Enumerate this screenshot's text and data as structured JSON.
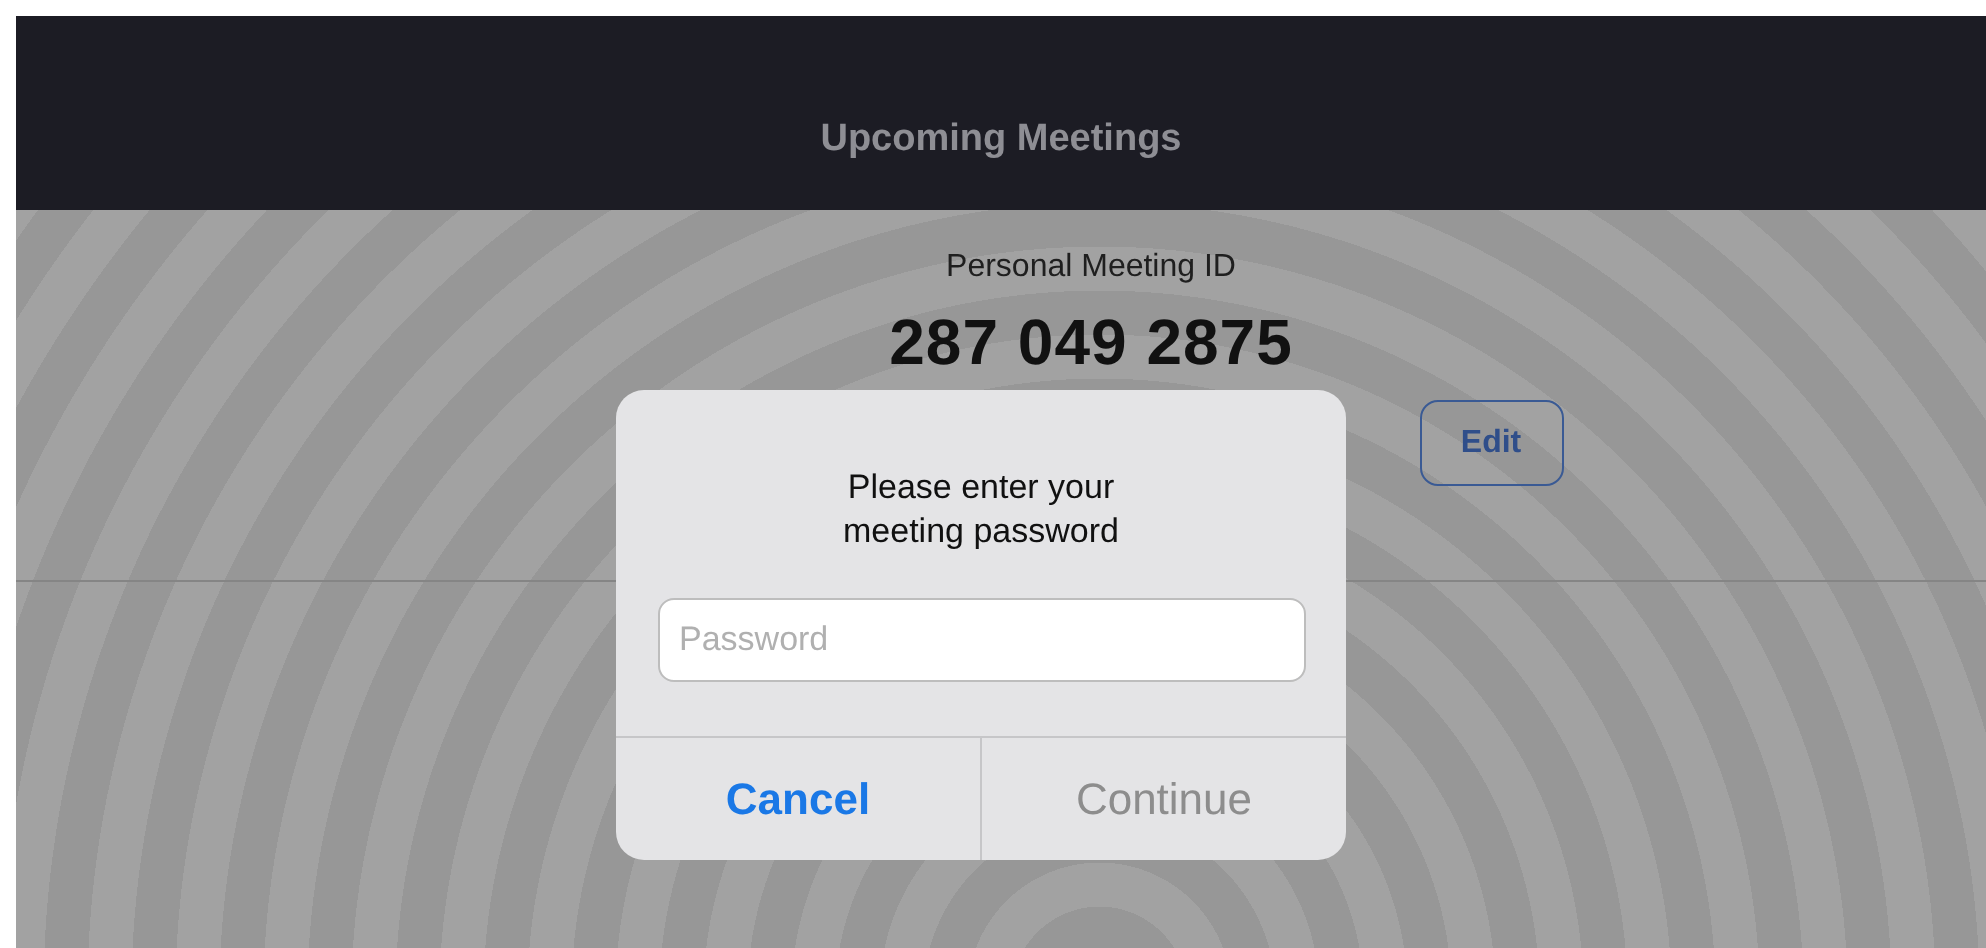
{
  "header": {
    "title": "Upcoming Meetings"
  },
  "personal_meeting": {
    "label": "Personal Meeting ID",
    "id": "287 049 2875",
    "edit_button": "Edit"
  },
  "dialog": {
    "message": "Please enter your meeting password",
    "password_field": {
      "placeholder": "Password"
    },
    "buttons": [
      {
        "label": "Cancel",
        "kind": "cancel",
        "disabled": false
      },
      {
        "label": "Continue",
        "kind": "confirm",
        "disabled": true
      }
    ]
  }
}
